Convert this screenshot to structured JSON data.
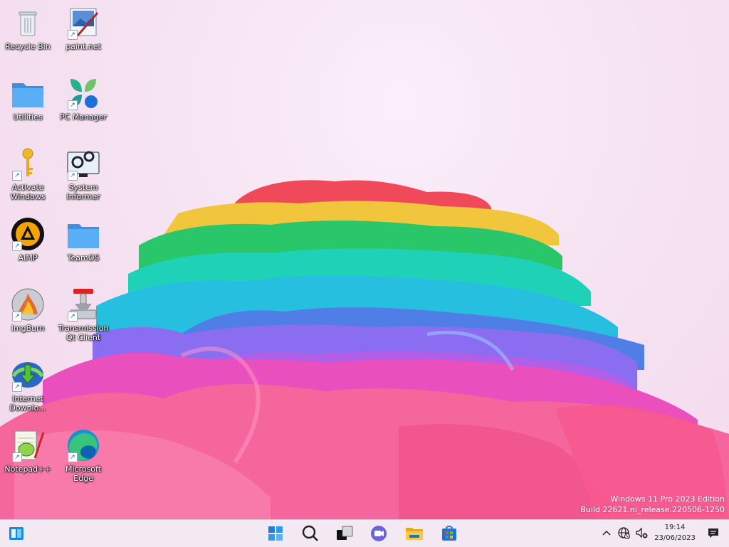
{
  "desktop": {
    "icons": [
      {
        "label": "Recycle Bin",
        "icon": "recycle-bin-icon",
        "shortcut": false
      },
      {
        "label": "paint.net",
        "icon": "paintnet-icon",
        "shortcut": true
      },
      {
        "label": "Utilities",
        "icon": "folder-icon",
        "shortcut": false
      },
      {
        "label": "PC Manager",
        "icon": "pc-manager-icon",
        "shortcut": true
      },
      {
        "label": "Activate Windows",
        "icon": "key-icon",
        "shortcut": true
      },
      {
        "label": "System Informer",
        "icon": "system-informer-icon",
        "shortcut": true
      },
      {
        "label": "AIMP",
        "icon": "aimp-icon",
        "shortcut": true
      },
      {
        "label": "TeamOS",
        "icon": "folder-icon",
        "shortcut": false
      },
      {
        "label": "ImgBurn",
        "icon": "imgburn-icon",
        "shortcut": true
      },
      {
        "label": "Transmission Qt Client",
        "icon": "transmission-icon",
        "shortcut": true
      },
      {
        "label": "Internet Downlo...",
        "icon": "idm-icon",
        "shortcut": true
      },
      {
        "label": "Notepad++",
        "icon": "notepadpp-icon",
        "shortcut": true
      },
      {
        "label": "Microsoft Edge",
        "icon": "edge-icon",
        "shortcut": true
      }
    ]
  },
  "watermark": {
    "line1": "Windows 11 Pro 2023 Edition",
    "line2": "Build 22621.ni_release.220506-1250"
  },
  "taskbar": {
    "left": {
      "icon": "widgets-icon"
    },
    "center": [
      "start-icon",
      "search-icon",
      "task-view-icon",
      "teams-chat-icon",
      "file-explorer-icon",
      "microsoft-store-icon"
    ],
    "tray": {
      "icons": [
        "chevron-up-icon",
        "network-globe-icon",
        "volume-muted-icon"
      ],
      "time": "19:14",
      "date": "23/06/2023",
      "notification_icon": "notification-icon"
    }
  },
  "colors": {
    "accent": "#0078d4",
    "folder": "#4aa3ef",
    "wallpaper_bg": "#f6e6f3"
  }
}
